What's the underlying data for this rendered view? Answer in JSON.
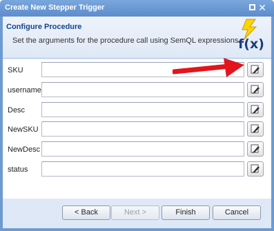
{
  "window": {
    "title": "Create New Stepper Trigger"
  },
  "header": {
    "title": "Configure Procedure",
    "description": "Set the arguments for the procedure call using SemQL expressions.",
    "icon": "function-fx-icon",
    "icon_text": "f(x)"
  },
  "fields": [
    {
      "label": "SKU",
      "value": ""
    },
    {
      "label": "username",
      "value": ""
    },
    {
      "label": "Desc",
      "value": ""
    },
    {
      "label": "NewSKU",
      "value": ""
    },
    {
      "label": "NewDesc",
      "value": ""
    },
    {
      "label": "status",
      "value": ""
    }
  ],
  "buttons": {
    "back": "< Back",
    "next": "Next >",
    "finish": "Finish",
    "cancel": "Cancel"
  },
  "colors": {
    "title_bar": "#5d8ccb",
    "header_title": "#15428b",
    "annotation_arrow": "#e3141b"
  }
}
